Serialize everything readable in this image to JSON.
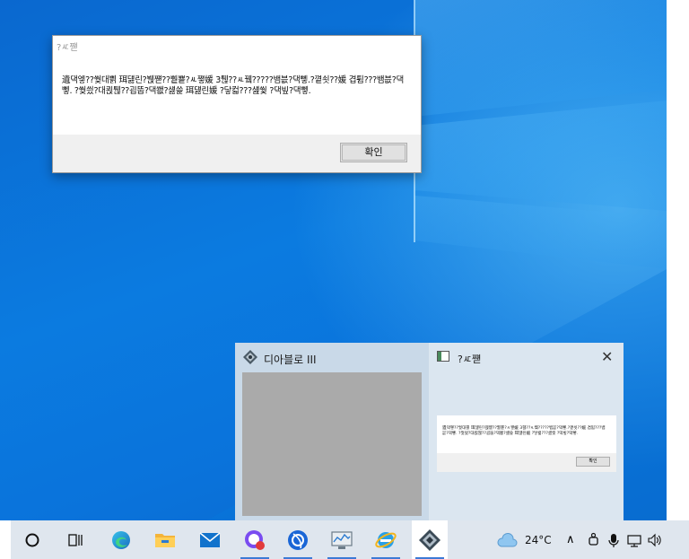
{
  "msgbox": {
    "title": "?ㅼ쨷",
    "message": "遺댁엫??쒖대쁽 珥덇린?붽쨷??쀁뿉?ㅻ쪟媛 3퉪??ㅻ뀈?????뱀븞?댁뼇.?꼍쇳??媛 겹튐???뱀븞?댁뼇. ?쒖씠?대쾭퉪??굅뚭?댁쐢?섏쓽 珥덇린媛 ?닿컯???섎쒗 ?댁빞?댁뼇.",
    "ok_label": "확인"
  },
  "previews": [
    {
      "title": "디아블로 III",
      "icon": "diablo-icon"
    },
    {
      "title": "?ㅼ쨷",
      "icon": "window-icon",
      "thumb_text": "遺댁엫??쒖대쁽 珥덇린?붽쨷??쀁뿉?ㅻ쪟媛 3퉪??ㅻ뀈?????뱀븞?댁뼇.?꼍쇳??媛 겹튐???뱀븞?댁뼇. ?쒖씠?대쾭퉪??굅뚭?댁쐢?섏쓽 珥덇린媛 ?닿컯???섎쒗 ?댁빞?댁뼇.",
      "thumb_ok": "확인",
      "close_glyph": "✕"
    }
  ],
  "taskbar": {
    "apps": [
      "cortana",
      "task-view",
      "edge",
      "file-explorer",
      "mail",
      "messenger",
      "battlenet",
      "performance-monitor",
      "internet-explorer",
      "diablo"
    ],
    "weather_temp": "24°C",
    "tray_chevron": "∧"
  },
  "colors": {
    "accent": "#3d7ad6",
    "desktop_blue": "#0a74d8",
    "taskbar": "#dfe6ee"
  }
}
